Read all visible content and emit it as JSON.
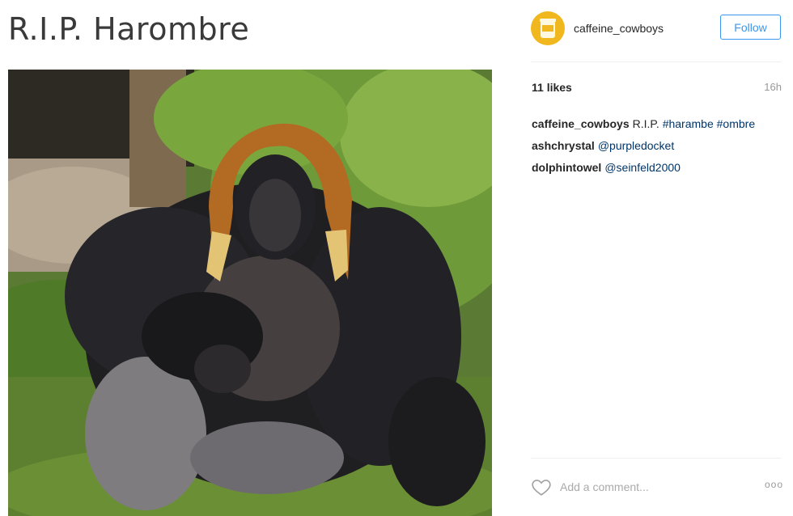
{
  "post": {
    "title": "R.I.P. Harombre",
    "image_alt": "gorilla-with-ombre-hair-photo"
  },
  "header": {
    "username": "caffeine_cowboys",
    "follow_label": "Follow",
    "avatar_icon": "coffee-cup-icon"
  },
  "stats": {
    "likes": "11 likes",
    "time": "16h"
  },
  "comments": [
    {
      "author": "caffeine_cowboys",
      "text": "R.I.P.",
      "tags": "#harambe #ombre"
    },
    {
      "author": "ashchrystal",
      "text": "",
      "tags": "@purpledocket"
    },
    {
      "author": "dolphintowel",
      "text": "",
      "tags": "@seinfeld2000"
    }
  ],
  "footer": {
    "comment_placeholder": "Add a comment...",
    "more_label": "ooo",
    "like_icon": "heart-outline-icon",
    "more_icon": "more-options-icon"
  },
  "colors": {
    "accent": "#3897f0",
    "link": "#003569",
    "avatar_bg": "#f0b81e"
  }
}
